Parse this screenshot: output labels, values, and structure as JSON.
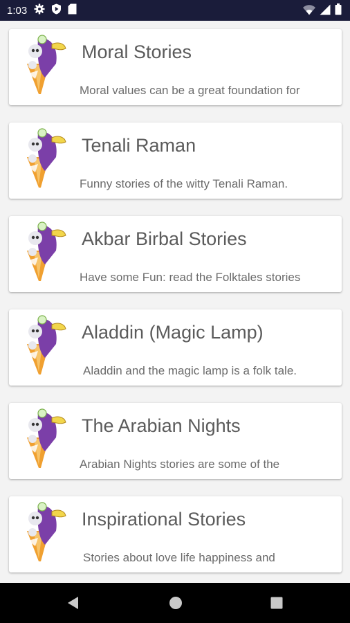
{
  "status_bar": {
    "time": "1:03",
    "left_icons": [
      "gear-icon",
      "shield-play-icon",
      "sd-card-icon"
    ],
    "right_icons": [
      "wifi-icon",
      "cell-signal-icon",
      "battery-icon"
    ]
  },
  "stories": [
    {
      "title": "Moral Stories",
      "description": "Moral values can be a great foundation for"
    },
    {
      "title": "Tenali Raman",
      "description": "Funny stories of the witty Tenali Raman."
    },
    {
      "title": "Akbar Birbal Stories",
      "description": "Have some Fun: read the Folktales stories"
    },
    {
      "title": "Aladdin (Magic Lamp)",
      "description": "Aladdin and the magic lamp is a folk tale."
    },
    {
      "title": "The Arabian Nights",
      "description": "Arabian Nights stories are some of the"
    },
    {
      "title": "Inspirational Stories",
      "description": "Stories about love life happiness and"
    }
  ],
  "thumbnail": {
    "icon": "wizard-mascot-icon",
    "colors": {
      "hat": "#7b3fa8",
      "cone": "#f0a030",
      "face": "#e8e8ee",
      "lamp": "#f2d64b"
    }
  },
  "nav_bar": {
    "icons": [
      "back-icon",
      "home-icon",
      "recents-icon"
    ]
  }
}
